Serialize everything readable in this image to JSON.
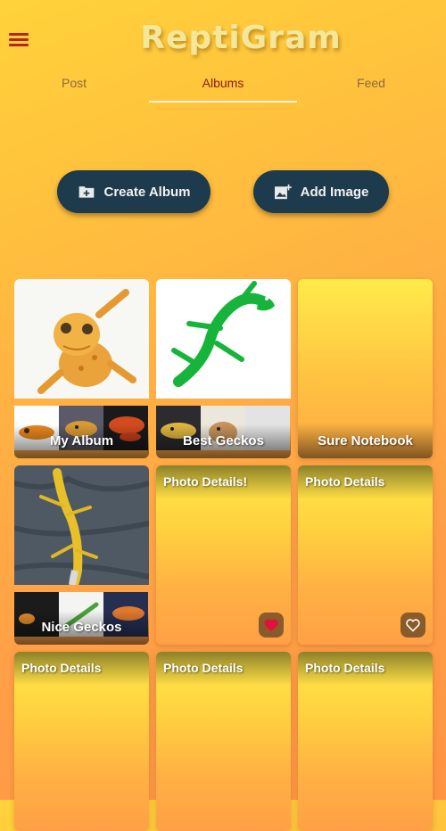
{
  "app": {
    "title": "ReptiGram",
    "accent": "#b3261e",
    "button_color": "#1d3b4c"
  },
  "menu": {
    "icon": "hamburger-menu-icon"
  },
  "tabs": [
    {
      "label": "Post"
    },
    {
      "label": "Albums"
    },
    {
      "label": "Feed"
    }
  ],
  "active_tab": "Albums",
  "actions": {
    "create_album": {
      "label": "Create Album",
      "icon": "folder-plus-icon"
    },
    "add_image": {
      "label": "Add Image",
      "icon": "add-photo-icon"
    }
  },
  "albums": [
    {
      "name": "My Album"
    },
    {
      "name": "Best Geckos"
    },
    {
      "name": "Sure Notebook"
    },
    {
      "name": "Nice Geckos"
    }
  ],
  "photos": [
    {
      "title": "Photo Details!",
      "favorite": true
    },
    {
      "title": "Photo Details",
      "favorite": false
    },
    {
      "title": "Photo Details"
    },
    {
      "title": "Photo Details"
    },
    {
      "title": "Photo Details"
    }
  ]
}
